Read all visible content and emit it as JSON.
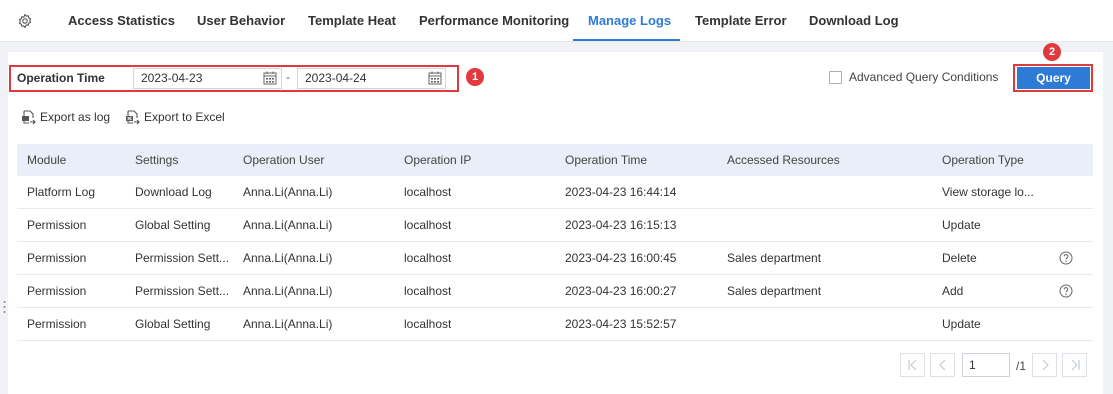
{
  "tabs": [
    {
      "label": "Access Statistics",
      "active": false
    },
    {
      "label": "User Behavior",
      "active": false
    },
    {
      "label": "Template Heat",
      "active": false
    },
    {
      "label": "Performance Monitoring",
      "active": false
    },
    {
      "label": "Manage Logs",
      "active": true
    },
    {
      "label": "Template Error",
      "active": false
    },
    {
      "label": "Download Log",
      "active": false
    }
  ],
  "filter": {
    "label": "Operation Time",
    "start_date": "2023-04-23",
    "end_date": "2023-04-24",
    "separator": "-"
  },
  "annotations": {
    "badge1": "1",
    "badge2": "2"
  },
  "advanced": {
    "label": "Advanced Query Conditions",
    "checked": false
  },
  "query_button": "Query",
  "export": {
    "as_log": "Export as log",
    "to_excel": "Export to Excel"
  },
  "table": {
    "columns": [
      "Module",
      "Settings",
      "Operation User",
      "Operation IP",
      "Operation Time",
      "Accessed Resources",
      "Operation Type"
    ],
    "rows": [
      [
        "Platform Log",
        "Download Log",
        "Anna.Li(Anna.Li)",
        "localhost",
        "2023-04-23 16:44:14",
        "",
        "View storage lo..."
      ],
      [
        "Permission",
        "Global Setting",
        "Anna.Li(Anna.Li)",
        "localhost",
        "2023-04-23 16:15:13",
        "",
        "Update"
      ],
      [
        "Permission",
        "Permission Sett...",
        "Anna.Li(Anna.Li)",
        "localhost",
        "2023-04-23 16:00:45",
        "Sales department",
        "Delete"
      ],
      [
        "Permission",
        "Permission Sett...",
        "Anna.Li(Anna.Li)",
        "localhost",
        "2023-04-23 16:00:27",
        "Sales department",
        "Add"
      ],
      [
        "Permission",
        "Global Setting",
        "Anna.Li(Anna.Li)",
        "localhost",
        "2023-04-23 15:52:57",
        "",
        "Update"
      ]
    ],
    "row_has_help": [
      false,
      false,
      true,
      true,
      false
    ]
  },
  "pagination": {
    "current": "1",
    "total": "/1"
  },
  "colors": {
    "accent": "#2e7bd6",
    "highlight": "#e0393e",
    "header_bg": "#e8eff8"
  }
}
